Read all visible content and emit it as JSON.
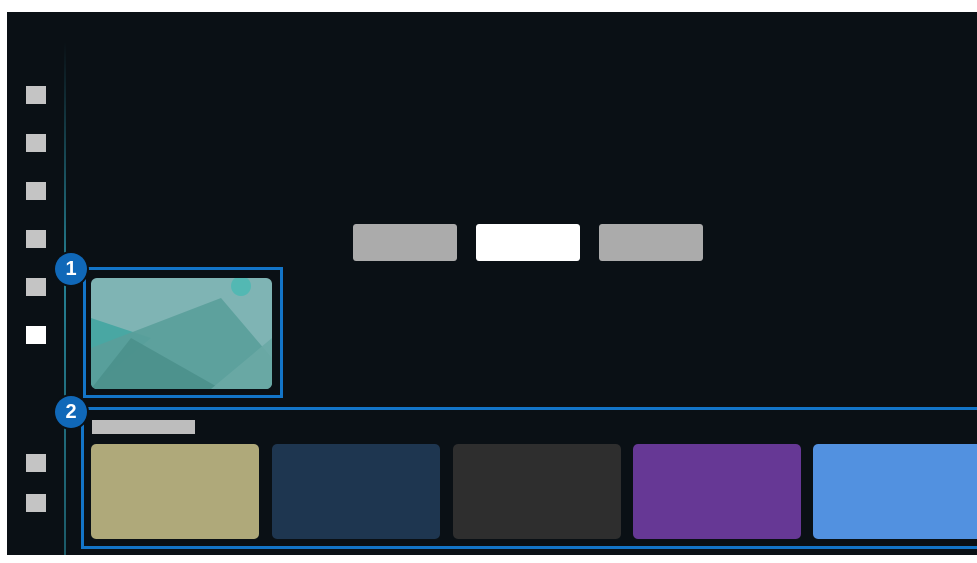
{
  "sidebar": {
    "items": [
      {
        "name": "menu-icon",
        "active": false
      },
      {
        "name": "menu-icon",
        "active": false
      },
      {
        "name": "menu-icon",
        "active": false
      },
      {
        "name": "menu-icon",
        "active": false
      },
      {
        "name": "menu-icon",
        "active": false
      },
      {
        "name": "menu-icon",
        "active": true
      },
      {
        "name": "menu-icon",
        "active": false
      },
      {
        "name": "menu-icon",
        "active": false
      }
    ]
  },
  "tabs": [
    {
      "active": false
    },
    {
      "active": true
    },
    {
      "active": false
    }
  ],
  "callouts": {
    "one": "1",
    "two": "2"
  },
  "colors": {
    "background": "#0a1015",
    "callout": "#1375c8",
    "accent_line": "#288ca0"
  },
  "content_row": {
    "tiles": [
      {
        "color": "#afa97a"
      },
      {
        "color": "#1e3650"
      },
      {
        "color": "#2e2e2e"
      },
      {
        "color": "#663895"
      },
      {
        "color": "#5291e0"
      }
    ]
  }
}
